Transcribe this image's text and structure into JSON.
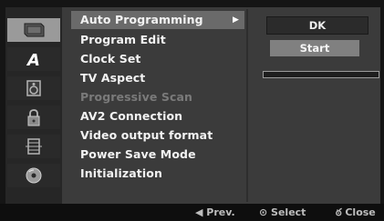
{
  "sidebar": {
    "icons": [
      {
        "name": "disc-tray-icon",
        "active": true
      },
      {
        "name": "language-a-icon",
        "active": false
      },
      {
        "name": "speaker-icon",
        "active": false
      },
      {
        "name": "lock-icon",
        "active": false
      },
      {
        "name": "film-icon",
        "active": false
      },
      {
        "name": "disc-icon",
        "active": false
      }
    ]
  },
  "menu": {
    "items": [
      {
        "label": "Auto Programming",
        "selected": true,
        "disabled": false,
        "has_submenu": true
      },
      {
        "label": "Program Edit",
        "selected": false,
        "disabled": false,
        "has_submenu": false
      },
      {
        "label": "Clock Set",
        "selected": false,
        "disabled": false,
        "has_submenu": false
      },
      {
        "label": "TV Aspect",
        "selected": false,
        "disabled": false,
        "has_submenu": false
      },
      {
        "label": "Progressive Scan",
        "selected": false,
        "disabled": true,
        "has_submenu": false
      },
      {
        "label": "AV2 Connection",
        "selected": false,
        "disabled": false,
        "has_submenu": false
      },
      {
        "label": "Video output format",
        "selected": false,
        "disabled": false,
        "has_submenu": false
      },
      {
        "label": "Power Save Mode",
        "selected": false,
        "disabled": false,
        "has_submenu": false
      },
      {
        "label": "Initialization",
        "selected": false,
        "disabled": false,
        "has_submenu": false
      }
    ],
    "submenu_arrow": "▶"
  },
  "right_pane": {
    "value_box": "DK",
    "start_button": "Start",
    "progress_percent": 0
  },
  "footer": {
    "prev": "◀ Prev.",
    "select": "⊙ Select",
    "close": "ఠ Close"
  },
  "colors": {
    "panel_bg": "#3b3b3b",
    "highlight": "#6a6a6a",
    "sidebar_active": "#9a9a9a"
  }
}
